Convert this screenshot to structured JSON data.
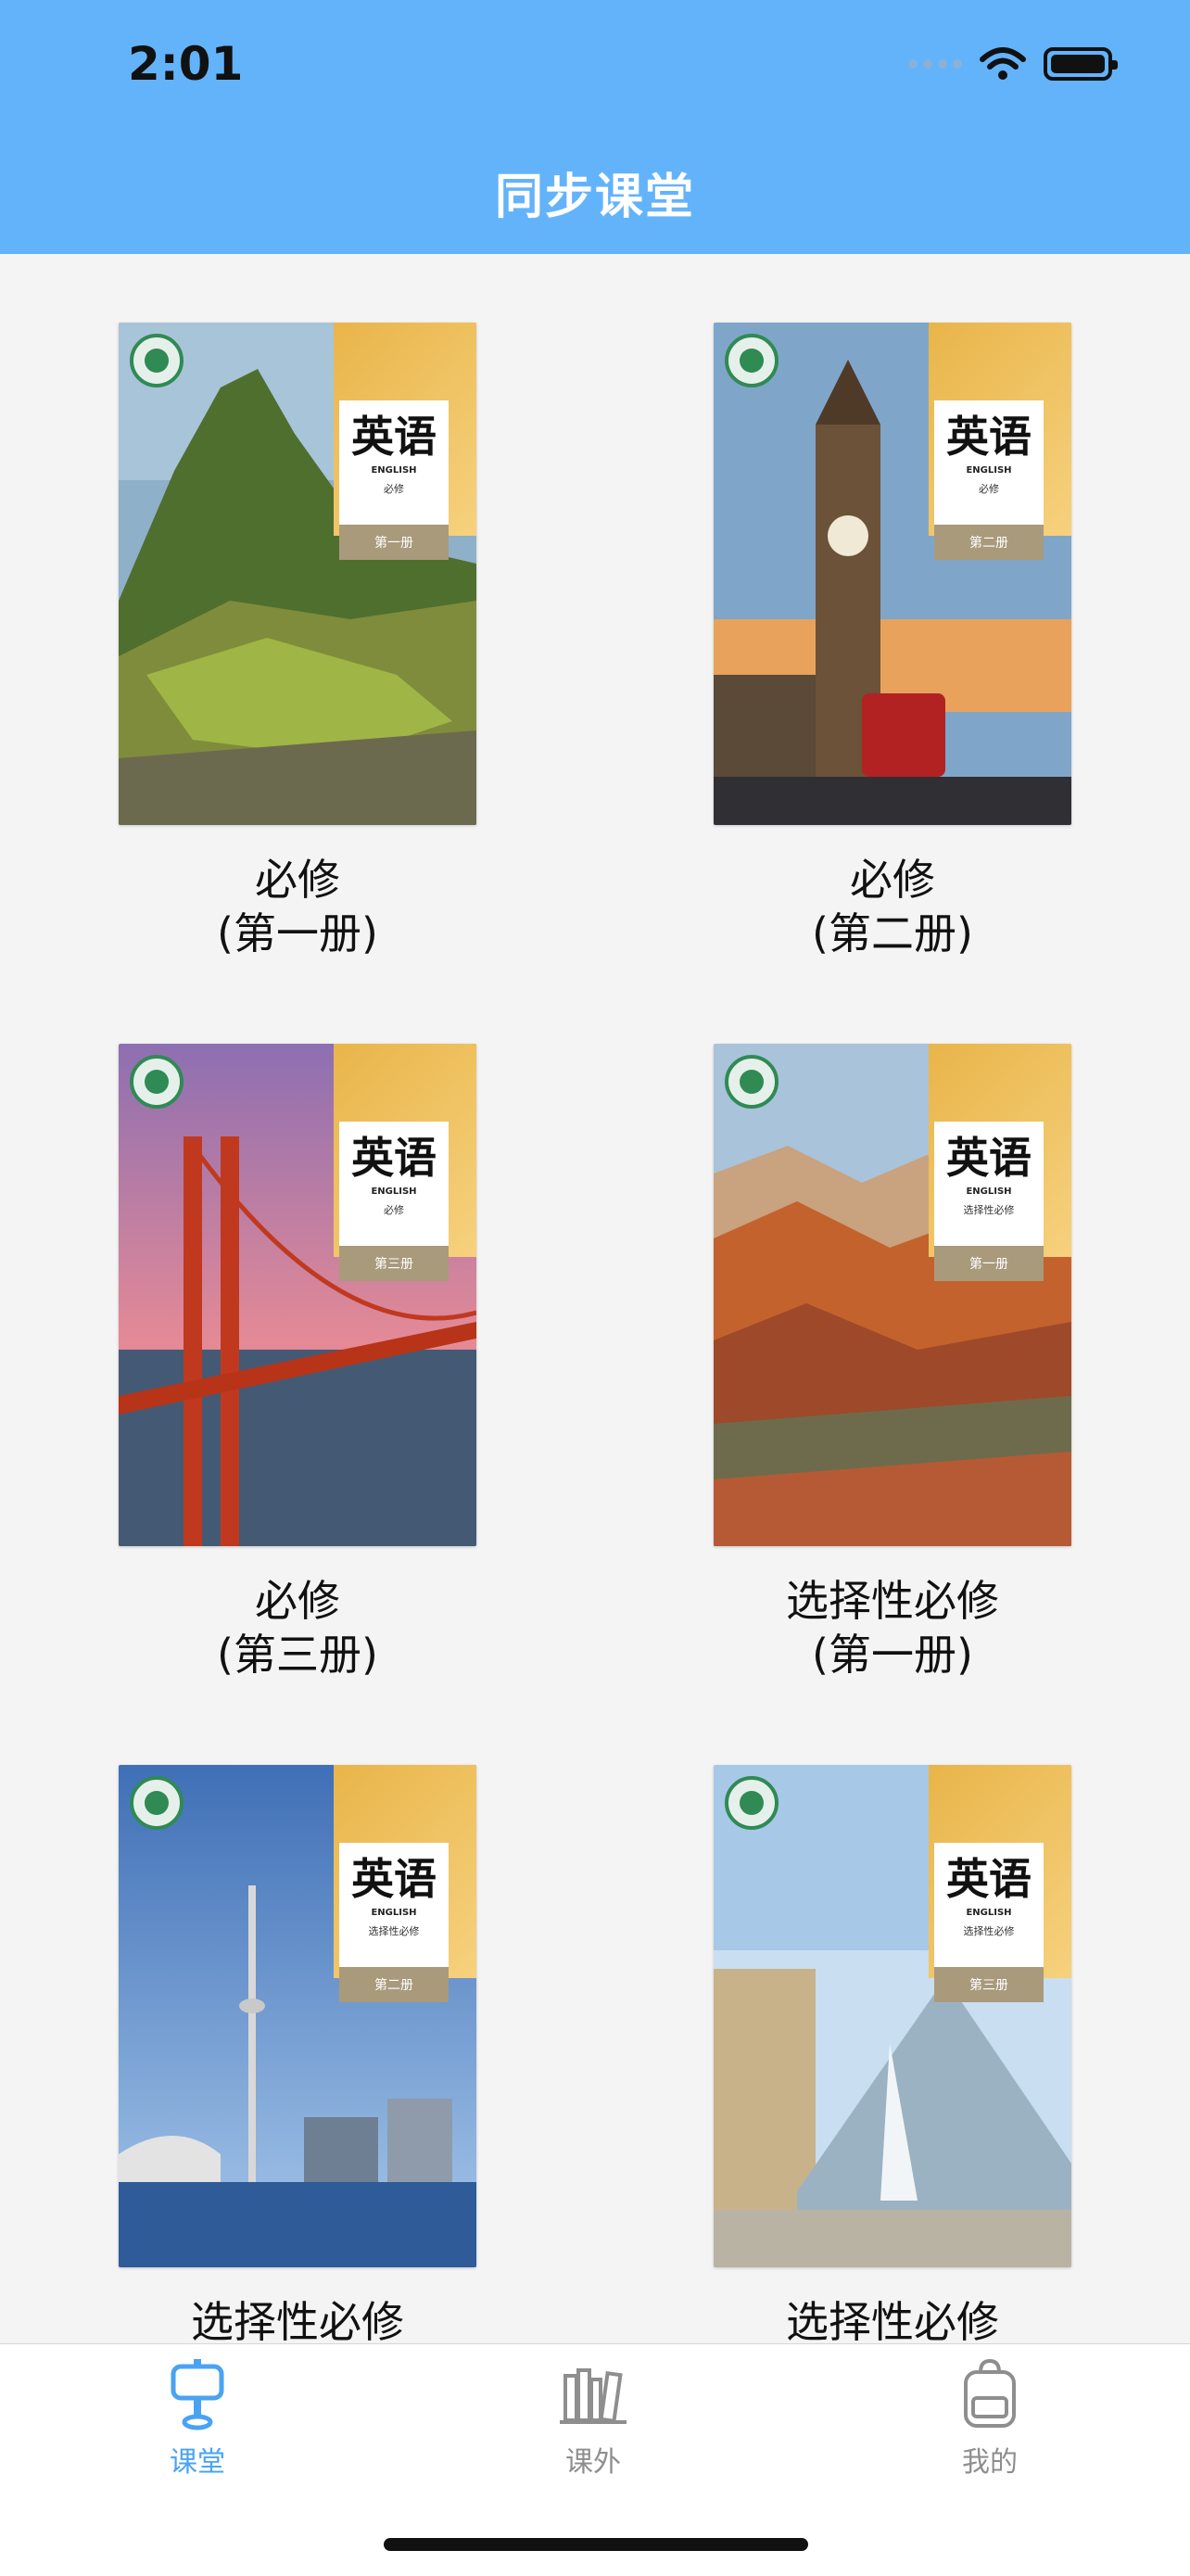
{
  "status_bar": {
    "time": "2:01"
  },
  "header": {
    "title": "同步课堂"
  },
  "books": [
    {
      "line1": "必修",
      "line2": "(第一册)",
      "cover_title": "英语",
      "cover_en": "ENGLISH",
      "cover_sub": "必修",
      "cover_volume": "第一册",
      "scene": "mountain-ruins"
    },
    {
      "line1": "必修",
      "line2": "(第二册)",
      "cover_title": "英语",
      "cover_en": "ENGLISH",
      "cover_sub": "必修",
      "cover_volume": "第二册",
      "scene": "clock-tower"
    },
    {
      "line1": "必修",
      "line2": "(第三册)",
      "cover_title": "英语",
      "cover_en": "ENGLISH",
      "cover_sub": "必修",
      "cover_volume": "第三册",
      "scene": "suspension-bridge"
    },
    {
      "line1": "选择性必修",
      "line2": "(第一册)",
      "cover_title": "英语",
      "cover_en": "ENGLISH",
      "cover_sub": "选择性必修",
      "cover_volume": "第一册",
      "scene": "rainbow-mountains"
    },
    {
      "line1": "选择性必修",
      "line2": "",
      "cover_title": "英语",
      "cover_en": "ENGLISH",
      "cover_sub": "选择性必修",
      "cover_volume": "第二册",
      "scene": "city-tower"
    },
    {
      "line1": "选择性必修",
      "line2": "",
      "cover_title": "英语",
      "cover_en": "ENGLISH",
      "cover_sub": "选择性必修",
      "cover_volume": "第三册",
      "scene": "glass-pyramid"
    }
  ],
  "tabbar": {
    "tabs": [
      {
        "label": "课堂",
        "icon": "podium-icon",
        "active": true
      },
      {
        "label": "课外",
        "icon": "bookshelf-icon",
        "active": false
      },
      {
        "label": "我的",
        "icon": "backpack-icon",
        "active": false
      }
    ]
  },
  "colors": {
    "header_bg": "#63b3fb",
    "active_tab": "#4aa3f2",
    "inactive_tab": "#8e8e8e"
  }
}
